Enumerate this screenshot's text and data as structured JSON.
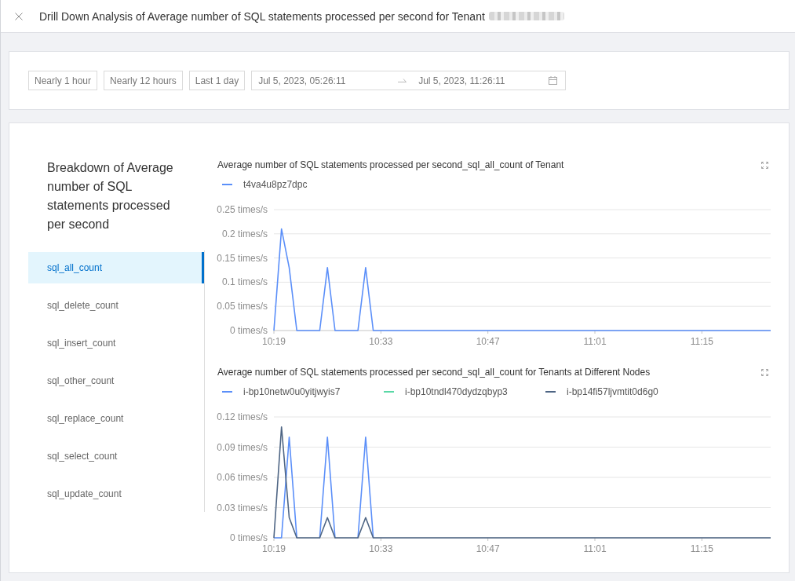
{
  "header": {
    "title": "Drill Down Analysis of Average number of SQL statements processed per second for Tenant",
    "tenant_blurred": true
  },
  "time_range": {
    "presets": [
      {
        "label": "Nearly 1 hour",
        "selected": false
      },
      {
        "label": "Nearly 12 hours",
        "selected": false
      },
      {
        "label": "Last 1 day",
        "selected": false
      }
    ],
    "start": "Jul 5, 2023, 05:26:11",
    "end": "Jul 5, 2023, 11:26:11"
  },
  "sidebar": {
    "title": "Breakdown of Average number of SQL statements processed per second",
    "items": [
      {
        "label": "sql_all_count",
        "selected": true
      },
      {
        "label": "sql_delete_count",
        "selected": false
      },
      {
        "label": "sql_insert_count",
        "selected": false
      },
      {
        "label": "sql_other_count",
        "selected": false
      },
      {
        "label": "sql_replace_count",
        "selected": false
      },
      {
        "label": "sql_select_count",
        "selected": false
      },
      {
        "label": "sql_update_count",
        "selected": false
      }
    ]
  },
  "charts": [
    {
      "chart_data": {
        "type": "line",
        "title": "Average number of SQL statements processed per second_sql_all_count of Tenant",
        "legend": "top",
        "grid": true,
        "categories": [
          "10:19",
          null,
          null,
          null,
          null,
          null,
          null,
          null,
          null,
          null,
          null,
          null,
          null,
          null,
          "10:33",
          null,
          null,
          null,
          null,
          null,
          null,
          null,
          null,
          null,
          null,
          null,
          null,
          null,
          "10:47",
          null,
          null,
          null,
          null,
          null,
          null,
          null,
          null,
          null,
          null,
          null,
          null,
          null,
          "11:01",
          null,
          null,
          null,
          null,
          null,
          null,
          null,
          null,
          null,
          null,
          null,
          null,
          null,
          "11:15",
          null,
          null,
          null,
          null,
          null,
          null,
          null,
          null,
          null
        ],
        "series": [
          {
            "name": "t4va4u8pz7dpc",
            "color": "#5b8ff9",
            "values": [
              0,
              0.21,
              0.13,
              0,
              0,
              0,
              0,
              0.13,
              0,
              0,
              0,
              0,
              0.13,
              0,
              0,
              0,
              0,
              0,
              0,
              0,
              0,
              0,
              0,
              0,
              0,
              0,
              0,
              0,
              0,
              0,
              0,
              0,
              0,
              0,
              0,
              0,
              0,
              0,
              0,
              0,
              0,
              0,
              0,
              0,
              0,
              0,
              0,
              0,
              0,
              0,
              0,
              0,
              0,
              0,
              0,
              0,
              0,
              0,
              0,
              0,
              0,
              0,
              0,
              0,
              0,
              0
            ]
          }
        ],
        "ylim": [
          0,
          0.25
        ],
        "yticks": [
          {
            "value": 0,
            "label": "0 times/s"
          },
          {
            "value": 0.05,
            "label": "0.05 times/s"
          },
          {
            "value": 0.1,
            "label": "0.1 times/s"
          },
          {
            "value": 0.15,
            "label": "0.15 times/s"
          },
          {
            "value": 0.2,
            "label": "0.2 times/s"
          },
          {
            "value": 0.25,
            "label": "0.25 times/s"
          }
        ]
      }
    },
    {
      "chart_data": {
        "type": "line",
        "title": "Average number of SQL statements processed per second_sql_all_count for Tenants at Different Nodes",
        "legend": "top",
        "grid": true,
        "categories": [
          "10:19",
          null,
          null,
          null,
          null,
          null,
          null,
          null,
          null,
          null,
          null,
          null,
          null,
          null,
          "10:33",
          null,
          null,
          null,
          null,
          null,
          null,
          null,
          null,
          null,
          null,
          null,
          null,
          null,
          "10:47",
          null,
          null,
          null,
          null,
          null,
          null,
          null,
          null,
          null,
          null,
          null,
          null,
          null,
          "11:01",
          null,
          null,
          null,
          null,
          null,
          null,
          null,
          null,
          null,
          null,
          null,
          null,
          null,
          "11:15",
          null,
          null,
          null,
          null,
          null,
          null,
          null,
          null,
          null
        ],
        "series": [
          {
            "name": "i-bp10netw0u0yitjwyis7",
            "color": "#5b8ff9",
            "values": [
              0,
              0,
              0.1,
              0,
              null,
              null,
              0,
              0.1,
              0,
              null,
              null,
              0,
              0.1,
              0,
              null,
              null,
              null,
              null,
              null,
              null,
              null,
              null,
              null,
              null,
              null,
              null,
              null,
              null,
              null,
              null,
              null,
              null,
              null,
              null,
              null,
              null,
              null,
              null,
              null,
              null,
              null,
              null,
              null,
              null,
              null,
              null,
              null,
              null,
              null,
              null,
              null,
              null,
              null,
              null,
              null,
              null,
              null,
              null,
              null,
              null,
              null,
              null,
              null,
              null,
              null,
              null
            ]
          },
          {
            "name": "i-bp10tndl470dydzqbyp3",
            "color": "#5ad8a6",
            "values": [
              null,
              null,
              null,
              null,
              null,
              null,
              null,
              null,
              null,
              null,
              null,
              null,
              null,
              null,
              null,
              null,
              null,
              null,
              null,
              null,
              null,
              null,
              null,
              null,
              null,
              null,
              null,
              null,
              null,
              null,
              null,
              null,
              null,
              null,
              null,
              null,
              null,
              null,
              null,
              null,
              null,
              null,
              null,
              null,
              null,
              null,
              null,
              null,
              null,
              null,
              null,
              null,
              null,
              null,
              null,
              null,
              null,
              null,
              null,
              null,
              null,
              null,
              null,
              null,
              null,
              null
            ]
          },
          {
            "name": "i-bp14fi57ljvmtit0d6g0",
            "color": "#4e6584",
            "values": [
              0,
              0.11,
              0.02,
              0,
              0,
              0,
              0,
              0.02,
              0,
              0,
              0,
              0,
              0.02,
              0,
              0,
              0,
              0,
              0,
              0,
              0,
              0,
              0,
              0,
              0,
              0,
              0,
              0,
              0,
              0,
              0,
              0,
              0,
              0,
              0,
              0,
              0,
              0,
              0,
              0,
              0,
              0,
              0,
              0,
              0,
              0,
              0,
              0,
              0,
              0,
              0,
              0,
              0,
              0,
              0,
              0,
              0,
              0,
              0,
              0,
              0,
              0,
              0,
              0,
              0,
              0,
              0
            ]
          }
        ],
        "ylim": [
          0,
          0.12
        ],
        "yticks": [
          {
            "value": 0,
            "label": "0 times/s"
          },
          {
            "value": 0.03,
            "label": "0.03 times/s"
          },
          {
            "value": 0.06,
            "label": "0.06 times/s"
          },
          {
            "value": 0.09,
            "label": "0.09 times/s"
          },
          {
            "value": 0.12,
            "label": "0.12 times/s"
          }
        ]
      }
    }
  ]
}
